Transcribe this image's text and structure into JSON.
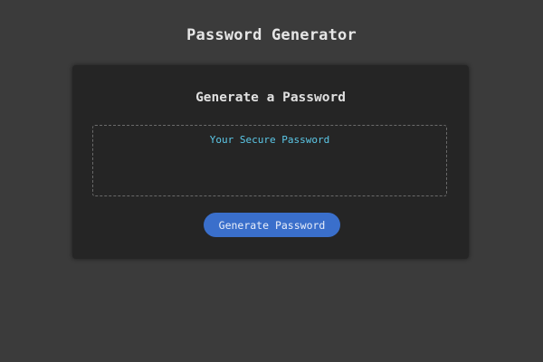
{
  "header": {
    "title": "Password Generator"
  },
  "card": {
    "title": "Generate a Password",
    "password_field": {
      "value": "",
      "placeholder": "Your Secure Password"
    },
    "generate_button_label": "Generate Password"
  },
  "colors": {
    "background": "#3b3b3b",
    "card_background": "#252525",
    "accent": "#3a6fcb",
    "placeholder_text": "#5cc8e8"
  }
}
